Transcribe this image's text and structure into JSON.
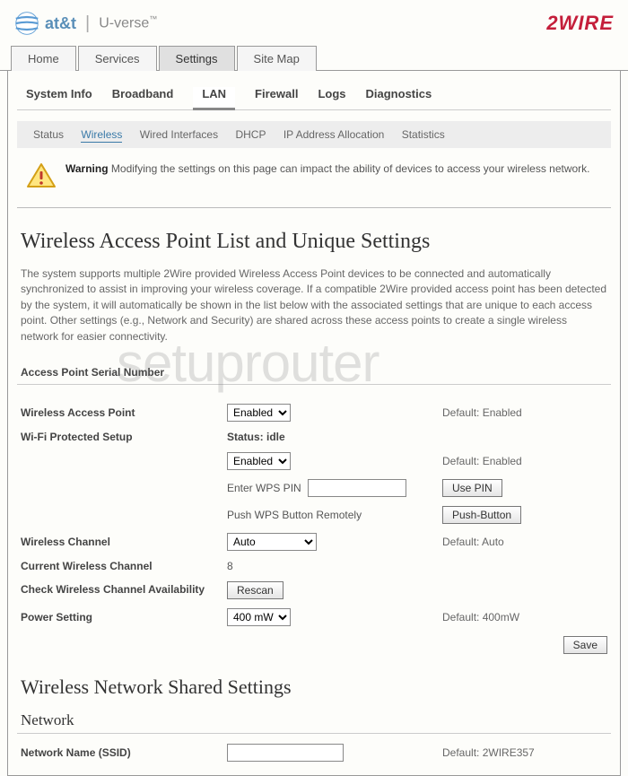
{
  "branding": {
    "att": "at&t",
    "uverse": "U-verse",
    "twowire": "2WIRE"
  },
  "mainTabs": {
    "home": "Home",
    "services": "Services",
    "settings": "Settings",
    "siteMap": "Site Map"
  },
  "subTabs": {
    "systemInfo": "System Info",
    "broadband": "Broadband",
    "lan": "LAN",
    "firewall": "Firewall",
    "logs": "Logs",
    "diagnostics": "Diagnostics"
  },
  "tertiaryNav": {
    "status": "Status",
    "wireless": "Wireless",
    "wired": "Wired Interfaces",
    "dhcp": "DHCP",
    "ipAlloc": "IP Address Allocation",
    "statistics": "Statistics"
  },
  "warning": {
    "label": "Warning",
    "text": "Modifying the settings on this page can impact the ability of devices to access your wireless network."
  },
  "page": {
    "title": "Wireless Access Point List and Unique Settings",
    "description": "The system supports multiple 2Wire provided Wireless Access Point devices to be connected and automatically synchronized to assist in improving your wireless coverage. If a compatible 2Wire provided access point has been detected by the system, it will automatically be shown in the list below with the associated settings that are unique to each access point. Other settings (e.g., Network and Security) are shared across these access points to create a single wireless network for easier connectivity.",
    "sectionAPSerial": "Access Point Serial Number",
    "sharedTitle": "Wireless Network Shared Settings",
    "networkHead": "Network"
  },
  "fields": {
    "wap": {
      "label": "Wireless Access Point",
      "value": "Enabled",
      "default": "Default: Enabled"
    },
    "wps": {
      "label": "Wi-Fi Protected Setup",
      "status": "Status: idle",
      "value": "Enabled",
      "default": "Default: Enabled"
    },
    "wpsPin": {
      "label": "Enter WPS PIN",
      "button": "Use PIN"
    },
    "wpsPush": {
      "label": "Push WPS Button Remotely",
      "button": "Push-Button"
    },
    "channel": {
      "label": "Wireless Channel",
      "value": "Auto",
      "default": "Default: Auto"
    },
    "currentChannel": {
      "label": "Current Wireless Channel",
      "value": "8"
    },
    "checkAvail": {
      "label": "Check Wireless Channel Availability",
      "button": "Rescan"
    },
    "power": {
      "label": "Power Setting",
      "value": "400 mW",
      "default": "Default: 400mW"
    },
    "ssid": {
      "label": "Network Name (SSID)",
      "default": "Default: 2WIRE357"
    }
  },
  "buttons": {
    "save": "Save"
  },
  "watermark": "setuprouter"
}
